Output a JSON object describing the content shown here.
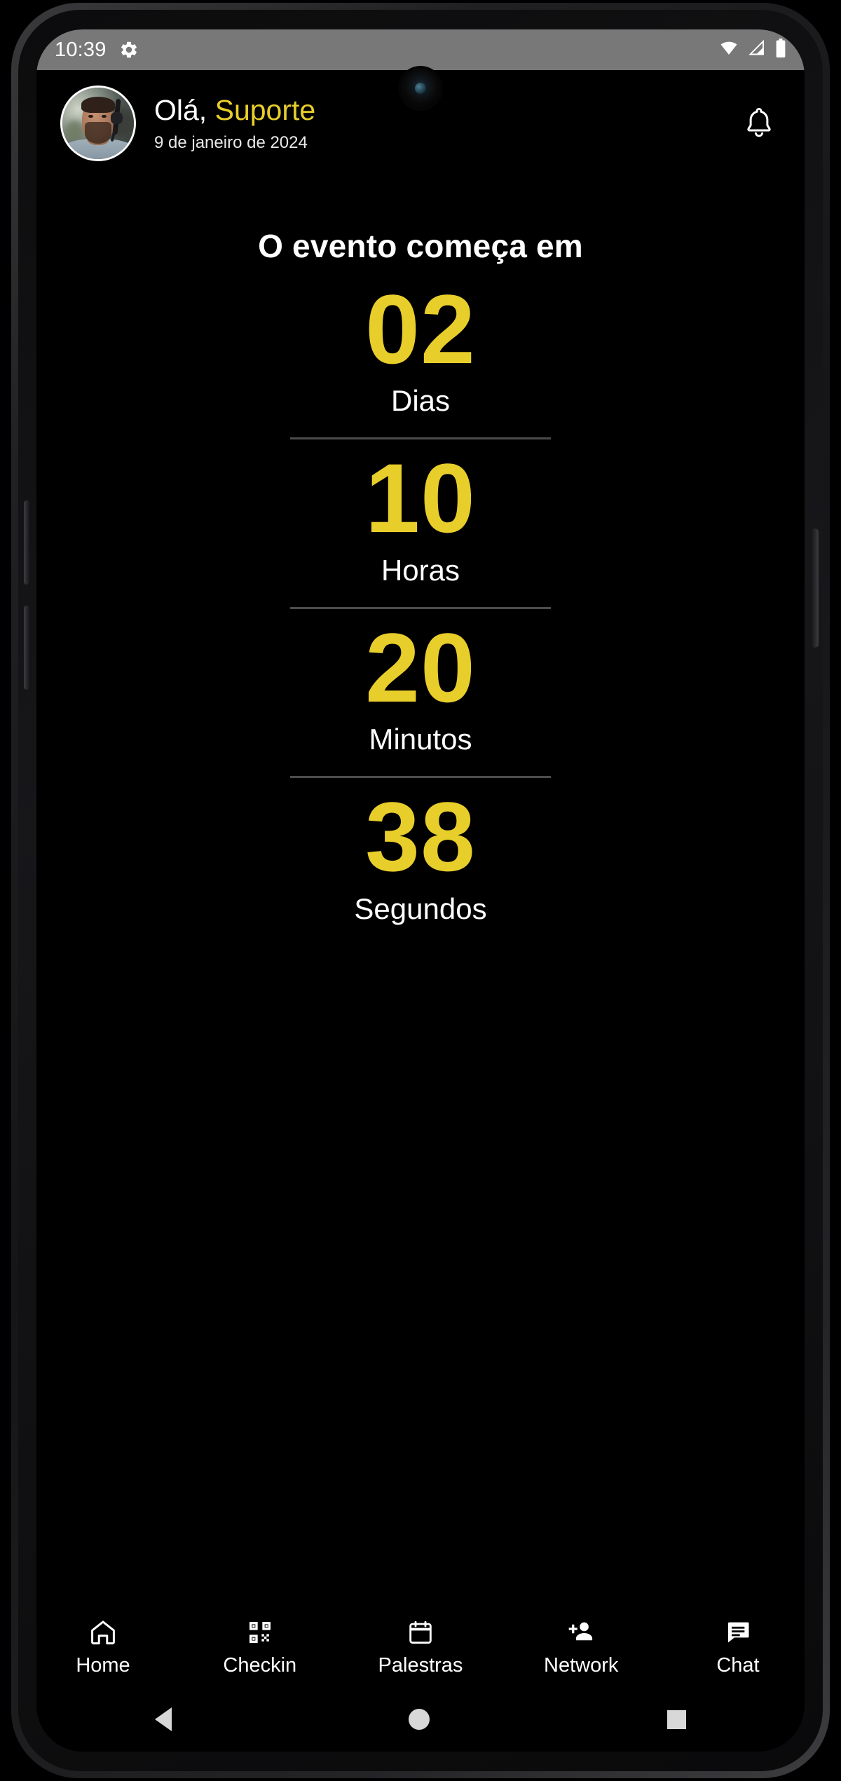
{
  "statusbar": {
    "time": "10:39",
    "settings_icon": "gear-icon",
    "wifi_icon": "wifi-icon",
    "signal_icon": "cellular-signal-icon",
    "battery_icon": "battery-full-icon"
  },
  "header": {
    "avatar": "user-avatar-photo",
    "greeting_prefix": "Olá, ",
    "user_name": "Suporte",
    "date": "9 de janeiro de 2024",
    "notification_icon": "bell-icon"
  },
  "countdown": {
    "title": "O evento começa em",
    "units": [
      {
        "value": "02",
        "label": "Dias"
      },
      {
        "value": "10",
        "label": "Horas"
      },
      {
        "value": "20",
        "label": "Minutos"
      },
      {
        "value": "38",
        "label": "Segundos"
      }
    ]
  },
  "bottom_nav": {
    "items": [
      {
        "label": "Home",
        "icon": "home-icon"
      },
      {
        "label": "Checkin",
        "icon": "qr-code-icon"
      },
      {
        "label": "Palestras",
        "icon": "calendar-icon"
      },
      {
        "label": "Network",
        "icon": "person-add-icon"
      },
      {
        "label": "Chat",
        "icon": "chat-bubble-icon"
      }
    ]
  },
  "system_nav": {
    "back": "back-triangle-icon",
    "home": "home-circle-icon",
    "recents": "recents-square-icon"
  },
  "colors": {
    "accent_yellow": "#e8ce2a",
    "background": "#000000",
    "statusbar_grey": "#787878",
    "separator": "#4c4c4c",
    "text_primary": "#ffffff"
  }
}
